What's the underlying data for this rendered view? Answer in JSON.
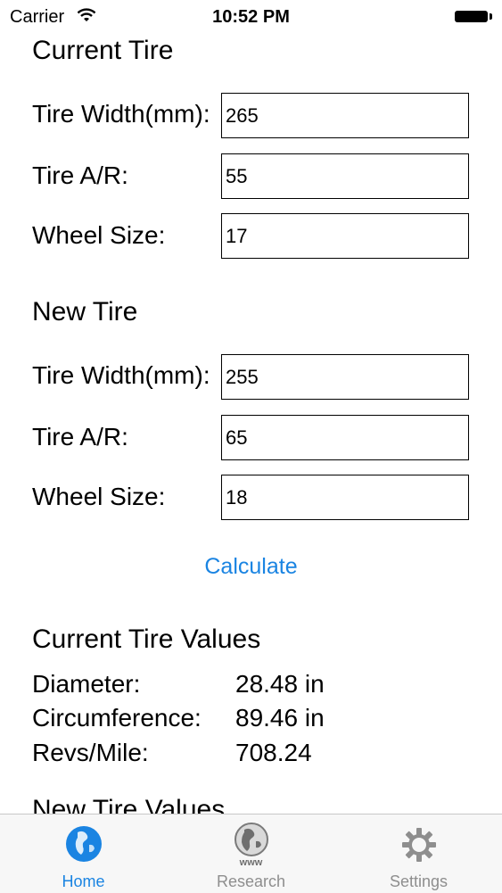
{
  "status_bar": {
    "carrier": "Carrier",
    "time": "10:52 PM"
  },
  "current_tire": {
    "title": "Current Tire",
    "width_label": "Tire Width(mm):",
    "width_value": "265",
    "ar_label": "Tire A/R:",
    "ar_value": "55",
    "wheel_label": "Wheel Size:",
    "wheel_value": "17"
  },
  "new_tire": {
    "title": "New Tire",
    "width_label": "Tire Width(mm):",
    "width_value": "255",
    "ar_label": "Tire A/R:",
    "ar_value": "65",
    "wheel_label": "Wheel Size:",
    "wheel_value": "18"
  },
  "calculate_label": "Calculate",
  "current_values": {
    "title": "Current Tire Values",
    "rows": [
      {
        "label": "Diameter:",
        "value": "28.48 in"
      },
      {
        "label": "Circumference:",
        "value": "89.46 in"
      },
      {
        "label": "Revs/Mile:",
        "value": "708.24"
      }
    ]
  },
  "new_values": {
    "title": "New Tire Values"
  },
  "tabbar": {
    "items": [
      {
        "label": "Home",
        "icon": "globe-icon"
      },
      {
        "label": "Research",
        "icon": "www-globe-icon",
        "icon_text": "www"
      },
      {
        "label": "Settings",
        "icon": "gear-icon"
      }
    ]
  },
  "colors": {
    "accent": "#1a84e2",
    "tab_inactive": "#8e8e8e"
  }
}
